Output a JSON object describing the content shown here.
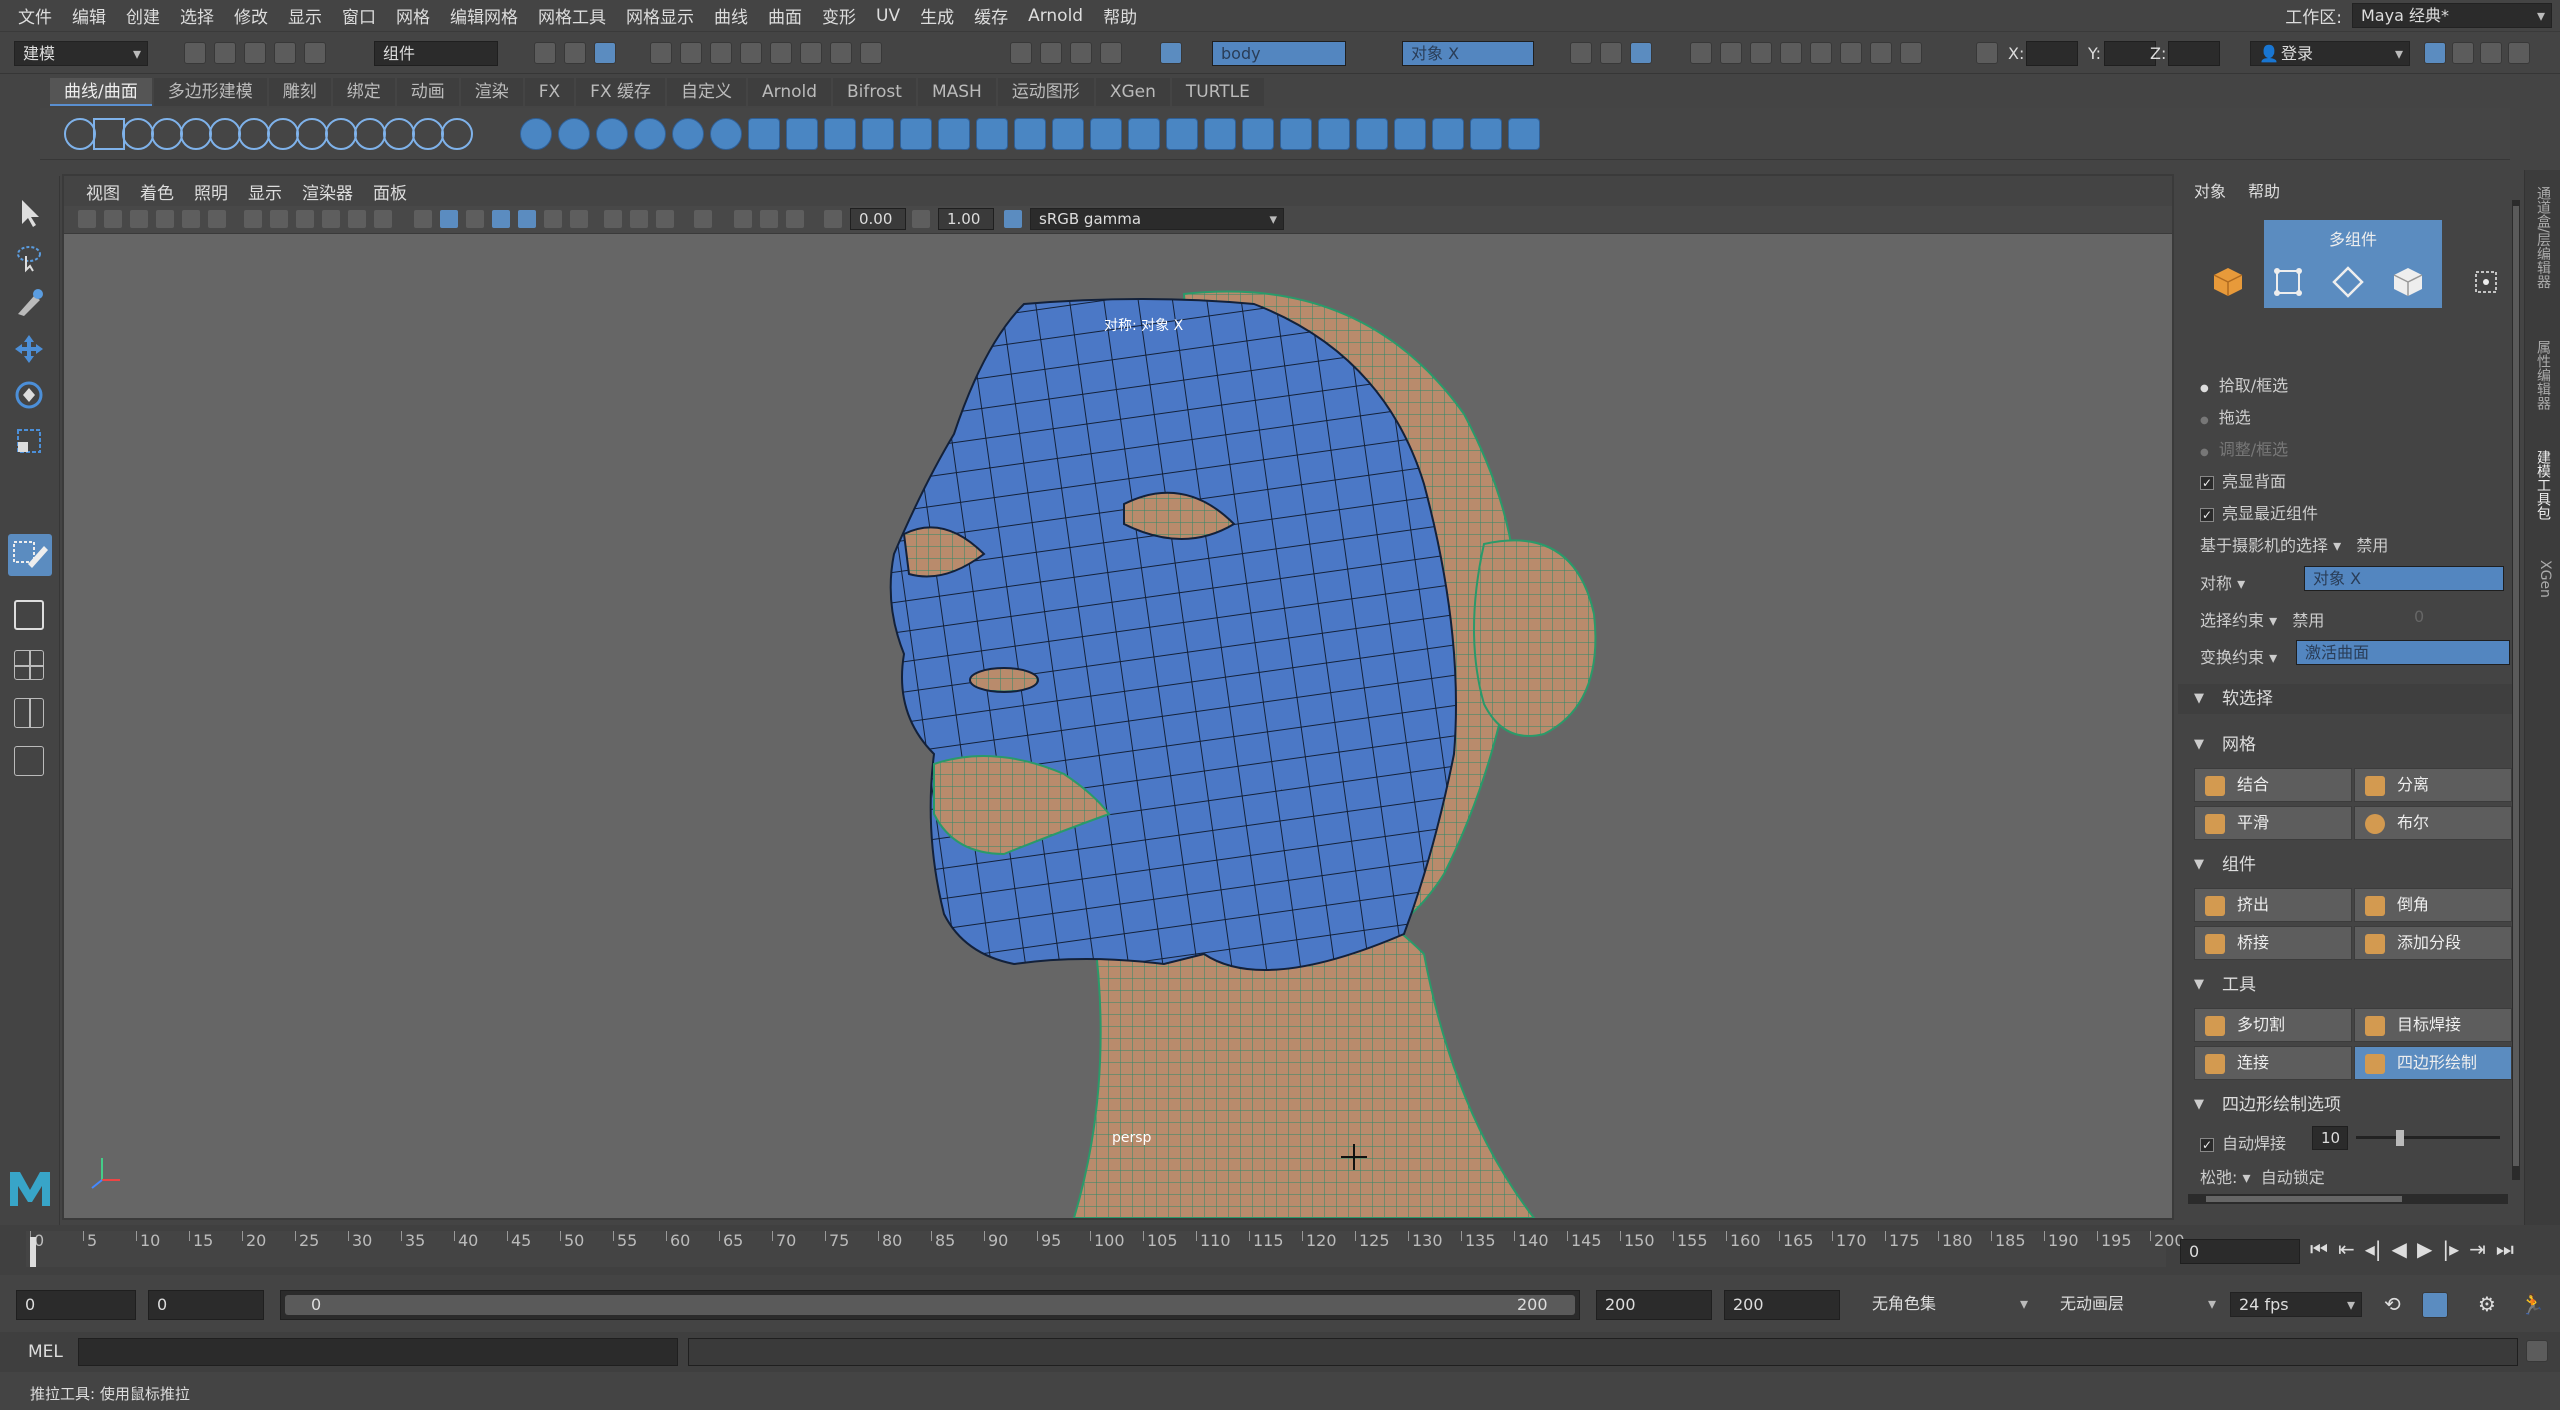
{
  "menu": {
    "items": [
      "文件",
      "编辑",
      "创建",
      "选择",
      "修改",
      "显示",
      "窗口",
      "网格",
      "编辑网格",
      "网格工具",
      "网格显示",
      "曲线",
      "曲面",
      "变形",
      "UV",
      "生成",
      "缓存",
      "Arnold",
      "帮助"
    ]
  },
  "workspace": {
    "label": "工作区:",
    "value": "Maya 经典*"
  },
  "statusline": {
    "mode": "建模",
    "select_mode": "组件",
    "object_name": "body",
    "symmetry": "对象 X",
    "x_label": "X:",
    "y_label": "Y:",
    "z_label": "Z:",
    "login": "登录"
  },
  "shelf": {
    "tabs": [
      "曲线/曲面",
      "多边形建模",
      "雕刻",
      "绑定",
      "动画",
      "渲染",
      "FX",
      "FX 缓存",
      "自定义",
      "Arnold",
      "Bifrost",
      "MASH",
      "运动图形",
      "XGen",
      "TURTLE"
    ],
    "active_tab": "曲线/曲面"
  },
  "viewport": {
    "menu": [
      "视图",
      "着色",
      "照明",
      "显示",
      "渲染器",
      "面板"
    ],
    "exposure": "0.00",
    "gamma": "1.00",
    "colorspace": "sRGB gamma",
    "symmetry_label": "对称: 对象 X",
    "camera": "persp"
  },
  "modeling_toolkit": {
    "menu": [
      "对象",
      "帮助"
    ],
    "component_mode": "多组件",
    "options": [
      {
        "label": "拾取/框选",
        "type": "radio",
        "checked": true
      },
      {
        "label": "拖选",
        "type": "radio",
        "checked": false
      },
      {
        "label": "调整/框选",
        "type": "radio",
        "checked": false,
        "disabled": true
      },
      {
        "label": "亮显背面",
        "type": "check",
        "checked": true
      },
      {
        "label": "亮显最近组件",
        "type": "check",
        "checked": true
      }
    ],
    "camera_select_label": "基于摄影机的选择",
    "camera_select_value": "禁用",
    "symmetry_label": "对称",
    "symmetry_value": "对象 X",
    "select_constraint_label": "选择约束",
    "select_constraint_value": "禁用",
    "select_constraint_num": "0",
    "transform_constraint_label": "变换约束",
    "transform_constraint_value": "激活曲面",
    "soft_select": "软选择",
    "sections": {
      "mesh": {
        "title": "网格",
        "buttons": [
          "结合",
          "分离",
          "平滑",
          "布尔"
        ]
      },
      "components": {
        "title": "组件",
        "buttons": [
          "挤出",
          "倒角",
          "桥接",
          "添加分段"
        ]
      },
      "tools": {
        "title": "工具",
        "buttons": [
          "多切割",
          "目标焊接",
          "连接",
          "四边形绘制"
        ],
        "active": "四边形绘制"
      }
    },
    "quad_draw_options": "四边形绘制选项",
    "auto_weld_label": "自动焊接",
    "auto_weld_value": "10",
    "relax_label": "松弛:",
    "relax_value": "自动锁定"
  },
  "right_tabs": [
    "通道盒/层编辑器",
    "属性编辑器",
    "建模工具包",
    "XGen"
  ],
  "timeline": {
    "ticks": [
      "0",
      "5",
      "10",
      "15",
      "20",
      "25",
      "30",
      "35",
      "40",
      "45",
      "50",
      "55",
      "60",
      "65",
      "70",
      "75",
      "80",
      "85",
      "90",
      "95",
      "100",
      "105",
      "110",
      "115",
      "120",
      "125",
      "130",
      "135",
      "140",
      "145",
      "150",
      "155",
      "160",
      "165",
      "170",
      "175",
      "180",
      "185",
      "190",
      "195",
      "200"
    ],
    "current_frame": "0"
  },
  "range": {
    "start": "0",
    "playback_start": "0",
    "slider_start": "0",
    "slider_end": "200",
    "playback_end": "200",
    "end": "200",
    "character_set": "无角色集",
    "anim_layer": "无动画层",
    "fps": "24 fps"
  },
  "mel": {
    "label": "MEL"
  },
  "helpline": {
    "text": "推拉工具: 使用鼠标推拉"
  },
  "colors": {
    "accent": "#5b8cc0",
    "viewport_bg": "#666666",
    "mesh_blue": "#4a76c8",
    "skin": "#b58a6a"
  }
}
